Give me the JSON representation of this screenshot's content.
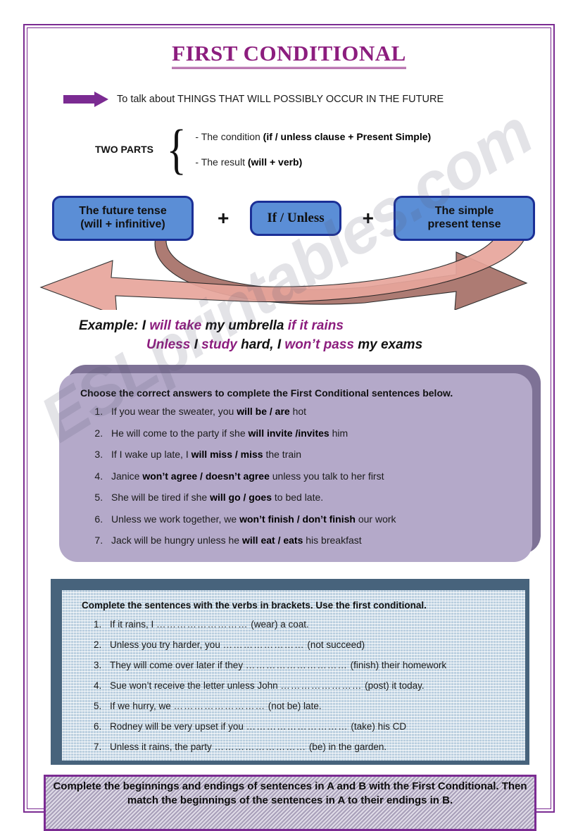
{
  "page": {
    "title": "FIRST CONDITIONAL",
    "watermark": "ESLprintables.com",
    "border_color": "#7b2b92",
    "title_color": "#8c1d7e"
  },
  "intro": {
    "arrow_icon": "right-arrow-icon",
    "text": "To talk about THINGS THAT WILL POSSIBLY OCCUR IN THE FUTURE"
  },
  "two_parts": {
    "label": "TWO PARTS",
    "brace": "{",
    "lines": [
      {
        "plain": "- The condition ",
        "bold": "(if / unless clause + Present Simple)"
      },
      {
        "plain": "- The result  ",
        "bold": "(will + verb)"
      }
    ]
  },
  "formula": {
    "box1_line1": "The future tense",
    "box1_line2": "(will + infinitive)",
    "plus1": "+",
    "box2": "If / Unless",
    "plus2": "+",
    "box3_line1": "The simple",
    "box3_line2": "present tense",
    "box_fill": "#5b8ed6",
    "box_border": "#1b2f96",
    "arrow_fill_light": "#e8a99f",
    "arrow_fill_dark": "#a9736c"
  },
  "example": {
    "lead": "Example:",
    "line1": [
      {
        "t": " I ",
        "hl": false
      },
      {
        "t": "will take",
        "hl": true
      },
      {
        "t": " my umbrella ",
        "hl": false
      },
      {
        "t": "if it rains",
        "hl": true
      }
    ],
    "line2": [
      {
        "t": "Unless",
        "hl": true
      },
      {
        "t": " I ",
        "hl": false
      },
      {
        "t": "study",
        "hl": true
      },
      {
        "t": " hard, I ",
        "hl": false
      },
      {
        "t": "won’t pass",
        "hl": true
      },
      {
        "t": " my exams",
        "hl": false
      }
    ],
    "highlight_color": "#8c1d7e"
  },
  "exercise1": {
    "heading": "Choose the correct answers to complete the First Conditional sentences below.",
    "bg_color": "#b4a9c9",
    "items": [
      {
        "pre": "If you wear the sweater, you ",
        "bold": "will be / are",
        "post": " hot"
      },
      {
        "pre": "He will come to the party if she ",
        "bold": "will invite /invites",
        "post": " him"
      },
      {
        "pre": "If I wake up late, I ",
        "bold": "will miss / miss",
        "post": " the train"
      },
      {
        "pre": "Janice ",
        "bold": "won’t agree / doesn’t agree",
        "post": " unless you talk to her first"
      },
      {
        "pre": "She will be tired if she ",
        "bold": "will go / goes",
        "post": " to bed late."
      },
      {
        "pre": "Unless we work together, we ",
        "bold": "won’t finish / don’t finish",
        "post": " our work"
      },
      {
        "pre": "Jack will be hungry unless he ",
        "bold": "will eat / eats",
        "post": " his breakfast"
      }
    ]
  },
  "exercise2": {
    "heading": "Complete the sentences with the verbs in brackets. Use the first conditional.",
    "bg_color": "#bcd0e0",
    "frame_color": "#47637c",
    "items": [
      {
        "pre": "If it rains, I ",
        "blank": "………………………",
        "post": " (wear) a coat."
      },
      {
        "pre": "Unless you try harder, you ",
        "blank": "……………………",
        "post": " (not succeed)"
      },
      {
        "pre": "They will come over later if they ",
        "blank": "…………………………",
        "post": " (finish) their homework"
      },
      {
        "pre": "Sue won’t receive the letter unless John ",
        "blank": "……………………",
        "post": " (post) it today."
      },
      {
        "pre": "If we hurry, we ",
        "blank": "………………………",
        "post": " (not be) late."
      },
      {
        "pre": "Rodney will be very upset if you ",
        "blank": "…………………………",
        "post": " (take) his CD"
      },
      {
        "pre": "Unless it rains, the party ",
        "blank": "………………………",
        "post": " (be) in the garden."
      }
    ]
  },
  "exercise3": {
    "heading": "Complete the beginnings and endings of sentences in A and B with the First Conditional. Then match the beginnings of the sentences in A to their endings in B.",
    "border_color": "#7b2b92"
  }
}
